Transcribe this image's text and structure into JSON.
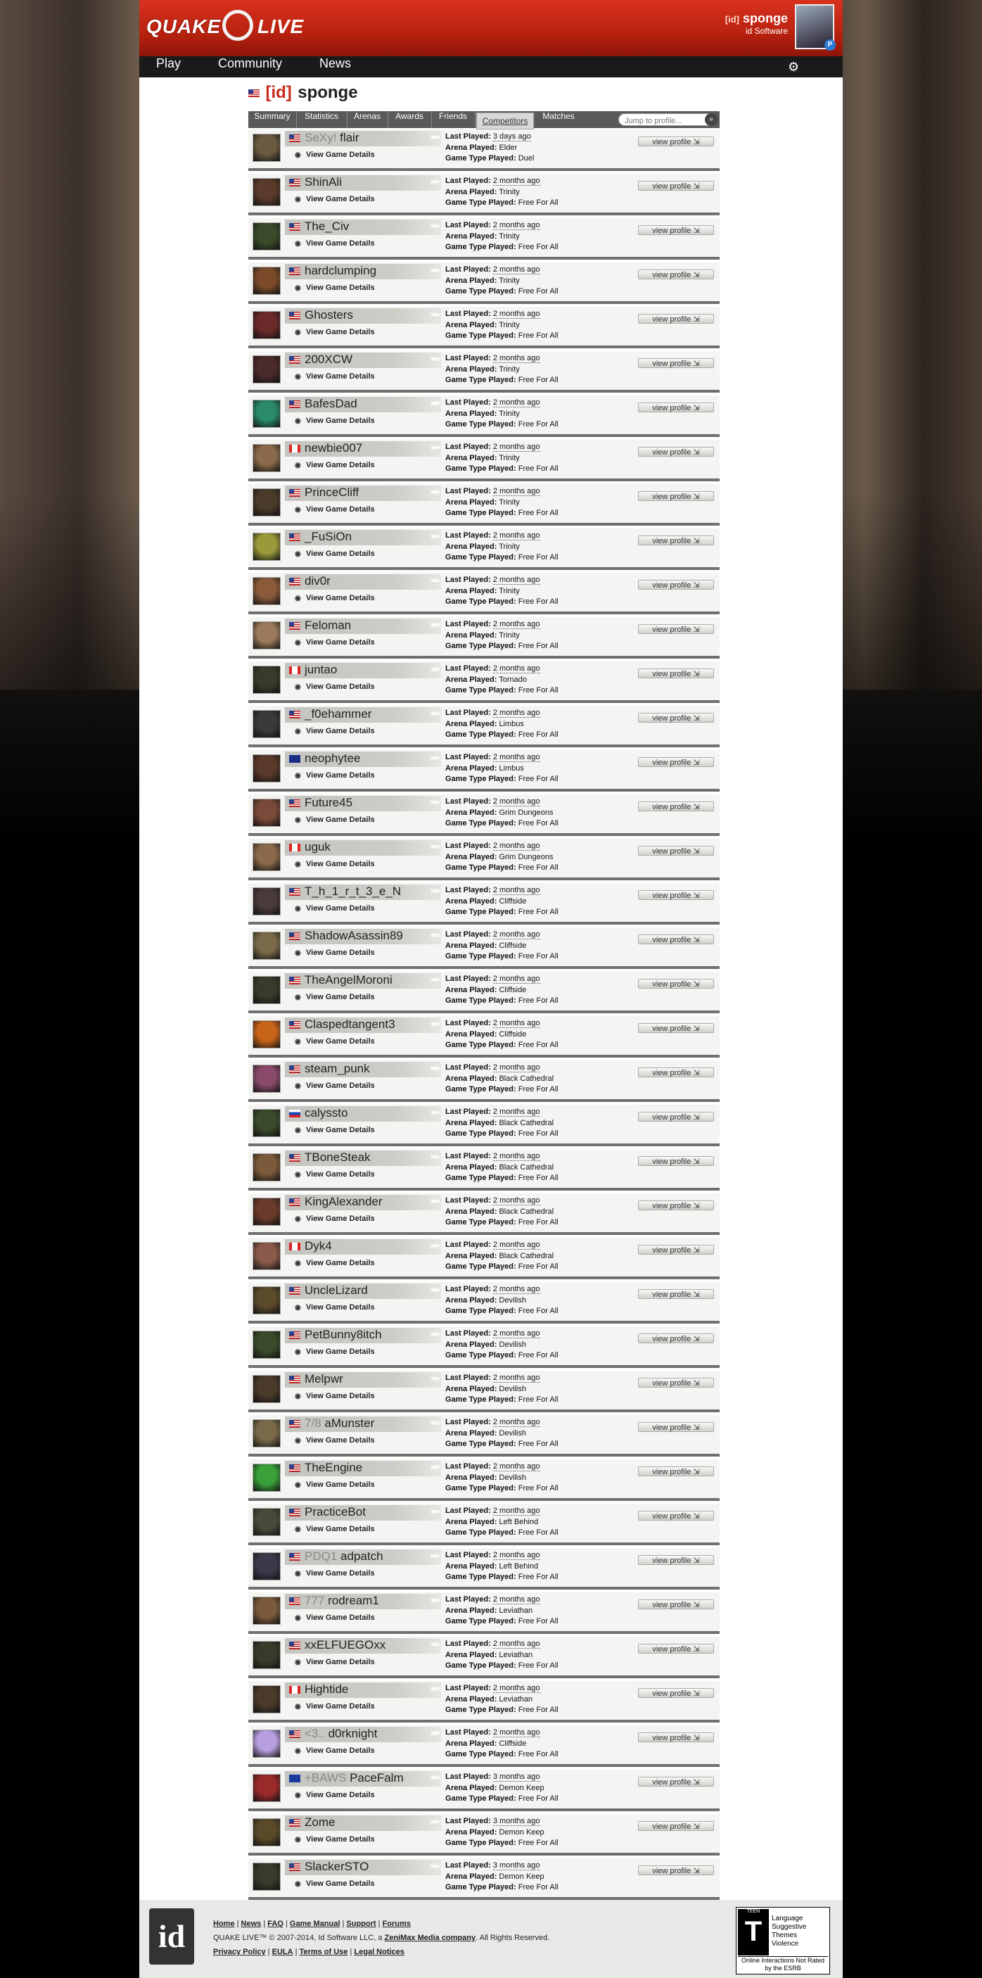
{
  "app": {
    "logo_left": "QUAKE",
    "logo_right": "LIVE"
  },
  "user": {
    "clan": "[id]",
    "name": "sponge",
    "org": "id Software",
    "badge": "P"
  },
  "nav": {
    "play": "Play",
    "community": "Community",
    "news": "News"
  },
  "profile": {
    "clan": "[id]",
    "name": "sponge"
  },
  "tabs": [
    {
      "label": "Summary"
    },
    {
      "label": "Statistics"
    },
    {
      "label": "Arenas"
    },
    {
      "label": "Awards"
    },
    {
      "label": "Friends"
    },
    {
      "label": "Competitors"
    },
    {
      "label": "Matches"
    }
  ],
  "search": {
    "placeholder": "Jump to profile..."
  },
  "labels": {
    "last_played": "Last Played:",
    "arena_played": "Arena Played:",
    "game_type": "Game Type Played:",
    "view_details": "View Game Details",
    "view_profile": "view profile"
  },
  "competitors": [
    {
      "tag": "SeXy!",
      "name": "flair",
      "flag": "us",
      "last": "3 days ago",
      "arena": "Elder",
      "type": "Duel",
      "color": "#6a5a40"
    },
    {
      "tag": "",
      "name": "ShinAli",
      "flag": "us",
      "last": "2 months ago",
      "arena": "Trinity",
      "type": "Free For All",
      "color": "#5a3a2a"
    },
    {
      "tag": "",
      "name": "The_Civ",
      "flag": "us",
      "last": "2 months ago",
      "arena": "Trinity",
      "type": "Free For All",
      "color": "#3a4a2a"
    },
    {
      "tag": "",
      "name": "hardclumping",
      "flag": "us",
      "last": "2 months ago",
      "arena": "Trinity",
      "type": "Free For All",
      "color": "#7a4a2a"
    },
    {
      "tag": "",
      "name": "Ghosters",
      "flag": "us",
      "last": "2 months ago",
      "arena": "Trinity",
      "type": "Free For All",
      "color": "#6a2a2a"
    },
    {
      "tag": "",
      "name": "200XCW",
      "flag": "us",
      "last": "2 months ago",
      "arena": "Trinity",
      "type": "Free For All",
      "color": "#4a2a2a"
    },
    {
      "tag": "",
      "name": "BafesDad",
      "flag": "us",
      "last": "2 months ago",
      "arena": "Trinity",
      "type": "Free For All",
      "color": "#2a8a6a"
    },
    {
      "tag": "",
      "name": "newbie007",
      "flag": "ca",
      "last": "2 months ago",
      "arena": "Trinity",
      "type": "Free For All",
      "color": "#8a6a4a"
    },
    {
      "tag": "",
      "name": "PrinceCliff",
      "flag": "us",
      "last": "2 months ago",
      "arena": "Trinity",
      "type": "Free For All",
      "color": "#4a3a2a"
    },
    {
      "tag": "",
      "name": "_FuSiOn",
      "flag": "us",
      "last": "2 months ago",
      "arena": "Trinity",
      "type": "Free For All",
      "color": "#9a9a3a"
    },
    {
      "tag": "",
      "name": "div0r",
      "flag": "us",
      "last": "2 months ago",
      "arena": "Trinity",
      "type": "Free For All",
      "color": "#8a5a3a"
    },
    {
      "tag": "",
      "name": "Feloman",
      "flag": "us",
      "last": "2 months ago",
      "arena": "Trinity",
      "type": "Free For All",
      "color": "#9a7a5a"
    },
    {
      "tag": "",
      "name": "juntao",
      "flag": "ca",
      "last": "2 months ago",
      "arena": "Tornado",
      "type": "Free For All",
      "color": "#3a3a2a"
    },
    {
      "tag": "",
      "name": "_f0ehammer",
      "flag": "us",
      "last": "2 months ago",
      "arena": "Limbus",
      "type": "Free For All",
      "color": "#3a3a3a"
    },
    {
      "tag": "",
      "name": "neophytee",
      "flag": "au",
      "last": "2 months ago",
      "arena": "Limbus",
      "type": "Free For All",
      "color": "#5a3a2a"
    },
    {
      "tag": "",
      "name": "Future45",
      "flag": "us",
      "last": "2 months ago",
      "arena": "Grim Dungeons",
      "type": "Free For All",
      "color": "#7a4a3a"
    },
    {
      "tag": "",
      "name": "uguk",
      "flag": "ca",
      "last": "2 months ago",
      "arena": "Grim Dungeons",
      "type": "Free For All",
      "color": "#8a6a4a"
    },
    {
      "tag": "",
      "name": "T_h_1_r_t_3_e_N",
      "flag": "us",
      "last": "2 months ago",
      "arena": "Cliffside",
      "type": "Free For All",
      "color": "#4a3a3a"
    },
    {
      "tag": "",
      "name": "ShadowAsassin89",
      "flag": "us",
      "last": "2 months ago",
      "arena": "Cliffside",
      "type": "Free For All",
      "color": "#7a6a4a"
    },
    {
      "tag": "",
      "name": "TheAngelMoroni",
      "flag": "us",
      "last": "2 months ago",
      "arena": "Cliffside",
      "type": "Free For All",
      "color": "#3a3a2a"
    },
    {
      "tag": "",
      "name": "Claspedtangent3",
      "flag": "us",
      "last": "2 months ago",
      "arena": "Cliffside",
      "type": "Free For All",
      "color": "#c8641a"
    },
    {
      "tag": "",
      "name": "steam_punk",
      "flag": "us",
      "last": "2 months ago",
      "arena": "Black Cathedral",
      "type": "Free For All",
      "color": "#8a4a6a"
    },
    {
      "tag": "",
      "name": "calyssto",
      "flag": "ru",
      "last": "2 months ago",
      "arena": "Black Cathedral",
      "type": "Free For All",
      "color": "#3a4a2a"
    },
    {
      "tag": "",
      "name": "TBoneSteak",
      "flag": "us",
      "last": "2 months ago",
      "arena": "Black Cathedral",
      "type": "Free For All",
      "color": "#7a5a3a"
    },
    {
      "tag": "",
      "name": "KingAlexander",
      "flag": "us",
      "last": "2 months ago",
      "arena": "Black Cathedral",
      "type": "Free For All",
      "color": "#6a3a2a"
    },
    {
      "tag": "",
      "name": "Dyk4",
      "flag": "ca",
      "last": "2 months ago",
      "arena": "Black Cathedral",
      "type": "Free For All",
      "color": "#8a5a4a"
    },
    {
      "tag": "",
      "name": "UncleLizard",
      "flag": "us",
      "last": "2 months ago",
      "arena": "Devilish",
      "type": "Free For All",
      "color": "#5a4a2a"
    },
    {
      "tag": "",
      "name": "PetBunny8itch",
      "flag": "us",
      "last": "2 months ago",
      "arena": "Devilish",
      "type": "Free For All",
      "color": "#3a4a2a"
    },
    {
      "tag": "",
      "name": "Melpwr",
      "flag": "us",
      "last": "2 months ago",
      "arena": "Devilish",
      "type": "Free For All",
      "color": "#4a3a2a"
    },
    {
      "tag": "7/8",
      "name": "aMunster",
      "flag": "us",
      "last": "2 months ago",
      "arena": "Devilish",
      "type": "Free For All",
      "color": "#7a6a4a"
    },
    {
      "tag": "",
      "name": "TheEngine",
      "flag": "us",
      "last": "2 months ago",
      "arena": "Devilish",
      "type": "Free For All",
      "color": "#3aa03a"
    },
    {
      "tag": "",
      "name": "PracticeBot",
      "flag": "us",
      "last": "2 months ago",
      "arena": "Left Behind",
      "type": "Free For All",
      "color": "#4a4a3a"
    },
    {
      "tag": "PDQ1",
      "name": "adpatch",
      "flag": "us",
      "last": "2 months ago",
      "arena": "Left Behind",
      "type": "Free For All",
      "color": "#3a3a4a"
    },
    {
      "tag": "777",
      "name": "rodream1",
      "flag": "us",
      "last": "2 months ago",
      "arena": "Leviathan",
      "type": "Free For All",
      "color": "#7a5a3a"
    },
    {
      "tag": "",
      "name": "xxELFUEGOxx",
      "flag": "us",
      "last": "2 months ago",
      "arena": "Leviathan",
      "type": "Free For All",
      "color": "#3a3a2a"
    },
    {
      "tag": "",
      "name": "Hightide",
      "flag": "ca",
      "last": "2 months ago",
      "arena": "Leviathan",
      "type": "Free For All",
      "color": "#4a3a2a"
    },
    {
      "tag": "<3..",
      "name": "d0rknight",
      "flag": "us",
      "last": "2 months ago",
      "arena": "Cliffside",
      "type": "Free For All",
      "color": "#b8a0e0"
    },
    {
      "tag": "+BAWS",
      "name": "PaceFalm",
      "flag": "eu",
      "last": "3 months ago",
      "arena": "Demon Keep",
      "type": "Free For All",
      "color": "#9a2a2a"
    },
    {
      "tag": "",
      "name": "Zome",
      "flag": "us",
      "last": "3 months ago",
      "arena": "Demon Keep",
      "type": "Free For All",
      "color": "#5a4a2a"
    },
    {
      "tag": "",
      "name": "SlackerSTO",
      "flag": "us",
      "last": "3 months ago",
      "arena": "Demon Keep",
      "type": "Free For All",
      "color": "#3a3a2a"
    }
  ],
  "footer": {
    "links": [
      "Home",
      "News",
      "FAQ",
      "Game Manual",
      "Support",
      "Forums"
    ],
    "copyright_pre": "QUAKE LIVE™ © 2007-2014, Id Software LLC, a",
    "company": "ZeniMax Media company",
    "copyright_post": ". All Rights Reserved.",
    "legal": [
      "Privacy Policy",
      "EULA",
      "Terms of Use",
      "Legal Notices"
    ],
    "id_logo": "id"
  },
  "esrb": {
    "rating": "T",
    "rating_label": "TEEN",
    "descriptors": [
      "Language",
      "Suggestive Themes",
      "Violence"
    ],
    "note": "Online Interactions Not Rated by the ESRB"
  }
}
